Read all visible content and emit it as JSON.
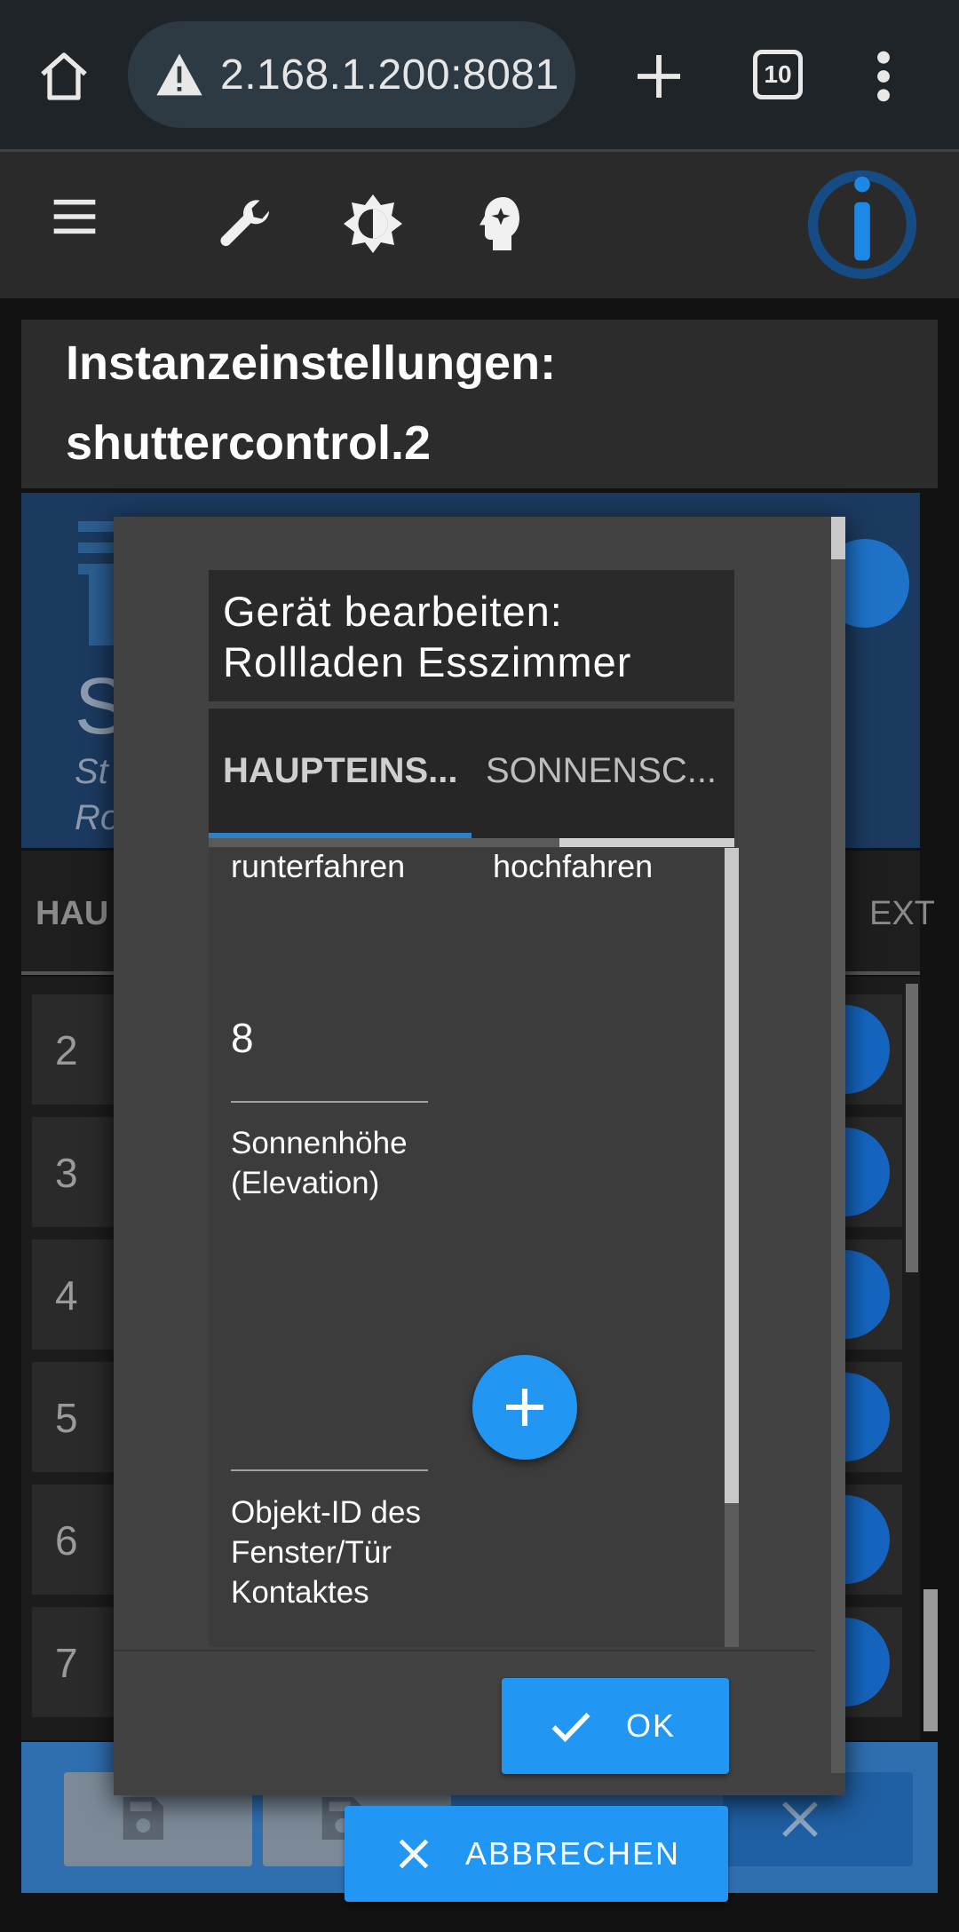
{
  "browser": {
    "url": "2.168.1.200:8081",
    "tab_count": "10"
  },
  "page": {
    "title_line1": "Instanzeinstellungen:",
    "title_line2": "shuttercontrol.2"
  },
  "background": {
    "banner_letter": "S",
    "banner_sub1": "St",
    "banner_sub2": "Ro",
    "tab_left": "HAU",
    "tab_right": "EXT",
    "rows": [
      "2",
      "3",
      "4",
      "5",
      "6",
      "7"
    ]
  },
  "dialog": {
    "title_line1": "Gerät bearbeiten:",
    "title_line2": "Rollladen Esszimmer",
    "tabs": [
      {
        "label": "HAUPTEINS...",
        "active": true
      },
      {
        "label": "SONNENSC...",
        "active": false
      }
    ],
    "col_left": "runterfahren",
    "col_right": "hochfahren",
    "elevation_value": "8",
    "elevation_label": "Sonnenhöhe (Elevation)",
    "contact_label": "Objekt-ID des Fenster/Tür Kontaktes",
    "ok_label": "OK",
    "cancel_label": "ABBRECHEN"
  },
  "colors": {
    "accent": "#2196f3",
    "dialog_bg": "#424242",
    "banner_bg": "#1b3a5f"
  }
}
